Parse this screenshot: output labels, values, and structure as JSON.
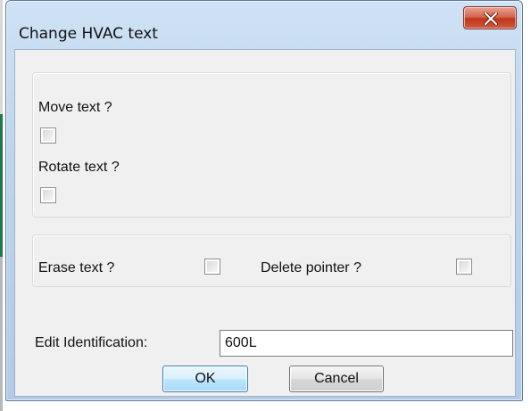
{
  "window": {
    "title": "Change HVAC text"
  },
  "group_top": {
    "move_text_label": "Move text ?",
    "move_text_checked": false,
    "rotate_text_label": "Rotate text ?",
    "rotate_text_checked": false
  },
  "group_bottom": {
    "erase_text_label": "Erase text ?",
    "erase_text_checked": false,
    "delete_pointer_label": "Delete pointer ?",
    "delete_pointer_checked": false
  },
  "edit_identification": {
    "label": "Edit Identification:",
    "value": "600L"
  },
  "buttons": {
    "ok_label": "OK",
    "cancel_label": "Cancel"
  },
  "icons": {
    "close": "close-x-icon"
  },
  "colors": {
    "close_button": "#c1351b",
    "frame": "#bed4ec",
    "client": "#f0f0f0"
  }
}
